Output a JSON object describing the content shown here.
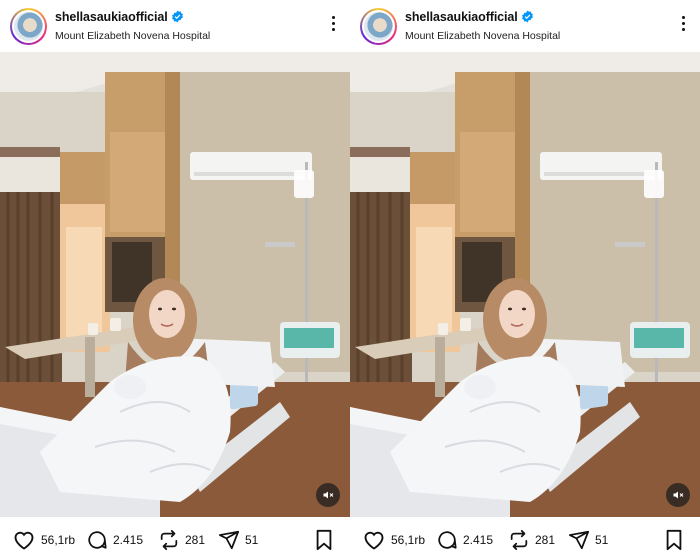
{
  "posts": [
    {
      "username": "shellasaukiaofficial",
      "location": "Mount Elizabeth Novena Hospital",
      "likes": "56,1rb",
      "comments": "2.415",
      "reposts": "281",
      "shares": "51"
    },
    {
      "username": "shellasaukiaofficial",
      "location": "Mount Elizabeth Novena Hospital",
      "likes": "56,1rb",
      "comments": "2.415",
      "reposts": "281",
      "shares": "51"
    }
  ],
  "icons": {
    "verified": "verified-badge-icon",
    "more": "more-options-icon",
    "like": "heart-icon",
    "comment": "comment-icon",
    "repost": "repost-icon",
    "share": "share-icon",
    "save": "bookmark-icon",
    "mute": "muted-speaker-icon"
  },
  "colors": {
    "verified_blue": "#0095f6",
    "text": "#111111"
  }
}
